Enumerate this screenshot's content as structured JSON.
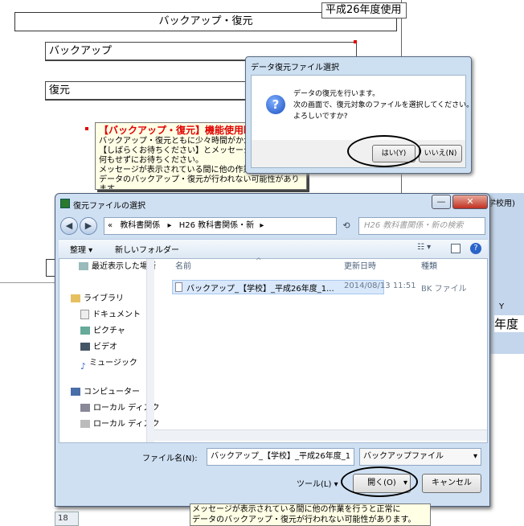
{
  "sheet": {
    "title": "バックアップ・復元",
    "year_badge": "平成26年度使用",
    "backup_label": "バックアップ",
    "restore_label": "復元",
    "note": {
      "title": "【バックアップ・復元】機能使用時",
      "line1": "バックアップ・復元ともに少々時間がかかりま",
      "line2": "【しばらくお待ちください】とメッセージが表示さ",
      "line3": "何もせずにお待ちください。",
      "line4": "メッセージが表示されている間に他の作業を",
      "line5": "データのバックアップ・復元が行われない可能性があります。"
    }
  },
  "msgbox": {
    "caption": "データ復元ファイル選択",
    "line1": "データの復元を行います。",
    "line2": "次の画面で、復元対象のファイルを選択してください。",
    "line3": "よろしいですか?",
    "yes": "はい(Y)",
    "no": "いいえ(N)",
    "icon": "question-icon"
  },
  "dialog": {
    "title": "復元ファイルの選択",
    "path_sep": "«",
    "crumb1": "教科書関係",
    "crumb2": "H26 教科書関係・新",
    "search_placeholder": "H26 教科書関係・新の検索",
    "organize": "整理 ▾",
    "new_folder": "新しいフォルダー",
    "nav": {
      "recent": "最近表示した場所",
      "library": "ライブラリ",
      "documents": "ドキュメント",
      "pictures": "ピクチャ",
      "videos": "ビデオ",
      "music": "ミュージック",
      "computer": "コンピューター",
      "local1": "ローカル ディスク",
      "local2": "ローカル ディスク"
    },
    "columns": {
      "name": "名前",
      "date": "更新日時",
      "type": "種類"
    },
    "file": {
      "name": "バックアップ_【学校】_平成26年度_1...",
      "date": "2014/08/13 11:51",
      "type": "BK ファイル"
    },
    "filename_label": "ファイル名(N):",
    "filename_value": "バックアップ_【学校】_平成26年度_1",
    "filter": "バックアップファイル",
    "tools": "ツール(L)",
    "open": "開く(O)",
    "cancel": "キャンセル"
  },
  "right_peek": {
    "tab": "学校用)",
    "cells": "Y",
    "year": "年度"
  },
  "bottom_note": {
    "line1": "メッセージが表示されている間に他の作業を行うと正常に",
    "line2": "データのバックアップ・復元が行われない可能性があります。"
  },
  "row_number": "18"
}
